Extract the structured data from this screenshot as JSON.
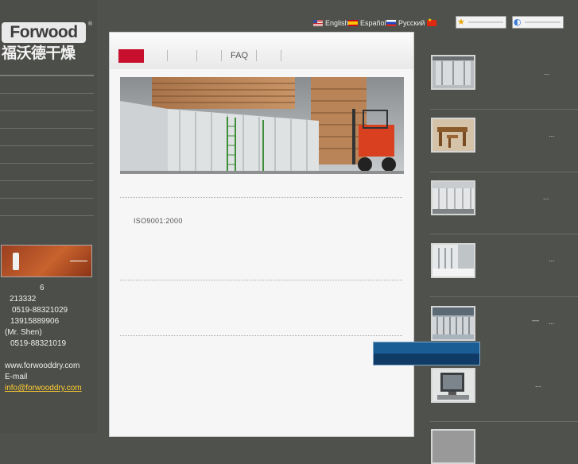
{
  "logo": {
    "wordmark": "Forwood",
    "registered": "®",
    "cn_name": "福沃德干燥"
  },
  "languages": [
    {
      "flag": "us",
      "label": "English"
    },
    {
      "flag": "es",
      "label": "Español"
    },
    {
      "flag": "ru",
      "label": "Русский"
    },
    {
      "flag": "cn",
      "label": ""
    }
  ],
  "top_buttons": [
    {
      "icon": "star-icon",
      "glyph": "★"
    },
    {
      "icon": "globe-icon",
      "glyph": "◐"
    }
  ],
  "topnav": {
    "faq_label": "FAQ"
  },
  "content": {
    "iso": "ISO9001:2000"
  },
  "contact": {
    "line1": "6",
    "postcode": "213332",
    "tel": "0519-88321029",
    "mobile": "13915889906",
    "person": "(Mr. Shen)",
    "fax": "0519-88321019",
    "website": "www.forwooddry.com",
    "email_label": "E-mail",
    "email": "info@forwooddry.com"
  },
  "right_list": [
    {
      "thumb": "kiln-door",
      "more": "..."
    },
    {
      "thumb": "wood-furniture",
      "more": "..."
    },
    {
      "thumb": "kiln-exterior",
      "more": "..."
    },
    {
      "thumb": "fan-room",
      "more": "..."
    },
    {
      "thumb": "kiln-row",
      "more": "... ",
      "dash": "—"
    },
    {
      "thumb": "control-monitor",
      "more": "..."
    }
  ],
  "colors": {
    "page_bg": "#4f514c",
    "nav_active": "#c8102e",
    "email_link": "#ffcc33",
    "cta_blue": "#1a5d94"
  }
}
